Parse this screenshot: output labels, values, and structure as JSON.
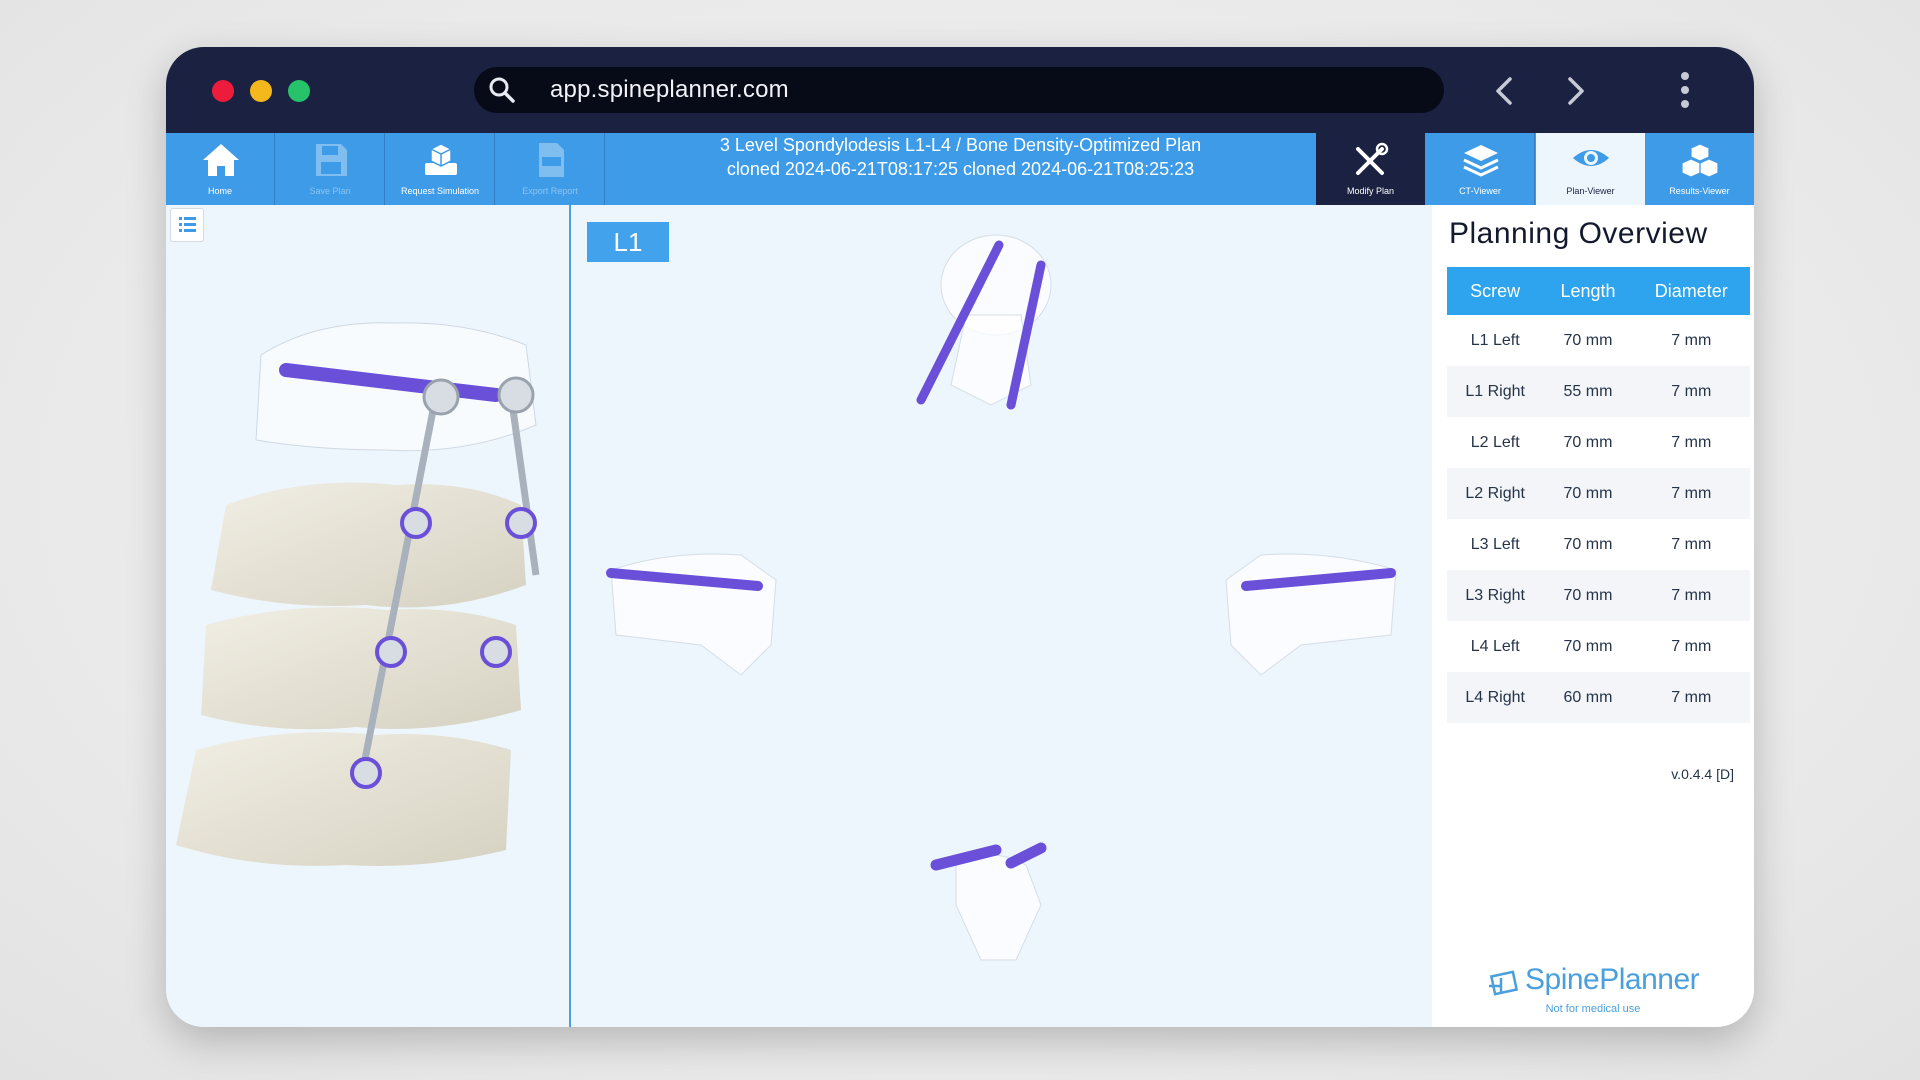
{
  "browser": {
    "url": "app.spineplanner.com"
  },
  "toolbar": {
    "home": "Home",
    "save_plan": "Save Plan",
    "request_simulation": "Request Simulation",
    "export_report": "Export Report",
    "modify_plan": "Modify Plan",
    "ct_viewer": "CT-Viewer",
    "plan_viewer": "Plan-Viewer",
    "results_viewer": "Results-Viewer"
  },
  "plan": {
    "title": "3 Level Spondylodesis L1-L4 / Bone Density-Optimized Plan cloned 2024-06-21T08:17:25 cloned 2024-06-21T08:25:23"
  },
  "viewport": {
    "level": "L1"
  },
  "overview": {
    "title": "Planning Overview",
    "columns": [
      "Screw",
      "Length",
      "Diameter"
    ],
    "rows": [
      {
        "screw": "L1 Left",
        "length": "70 mm",
        "diameter": "7 mm"
      },
      {
        "screw": "L1 Right",
        "length": "55 mm",
        "diameter": "7 mm"
      },
      {
        "screw": "L2 Left",
        "length": "70 mm",
        "diameter": "7 mm"
      },
      {
        "screw": "L2 Right",
        "length": "70 mm",
        "diameter": "7 mm"
      },
      {
        "screw": "L3 Left",
        "length": "70 mm",
        "diameter": "7 mm"
      },
      {
        "screw": "L3 Right",
        "length": "70 mm",
        "diameter": "7 mm"
      },
      {
        "screw": "L4 Left",
        "length": "70 mm",
        "diameter": "7 mm"
      },
      {
        "screw": "L4 Right",
        "length": "60 mm",
        "diameter": "7 mm"
      }
    ],
    "version": "v.0.4.4 [D]",
    "brand": "SpinePlanner",
    "disclaimer": "Not for medical use"
  },
  "colors": {
    "toolbar": "#3e9be8",
    "dark_chrome": "#1b2241",
    "table_header": "#2ea3ee",
    "screw": "#6a4fd8"
  },
  "icons": [
    "search-icon",
    "chevron-left-icon",
    "chevron-right-icon",
    "kebab-menu-icon",
    "home-icon",
    "save-icon",
    "simulation-icon",
    "pdf-icon",
    "tools-icon",
    "layers-icon",
    "eye-icon",
    "cubes-icon",
    "list-icon",
    "spineplanner-logo-icon"
  ]
}
